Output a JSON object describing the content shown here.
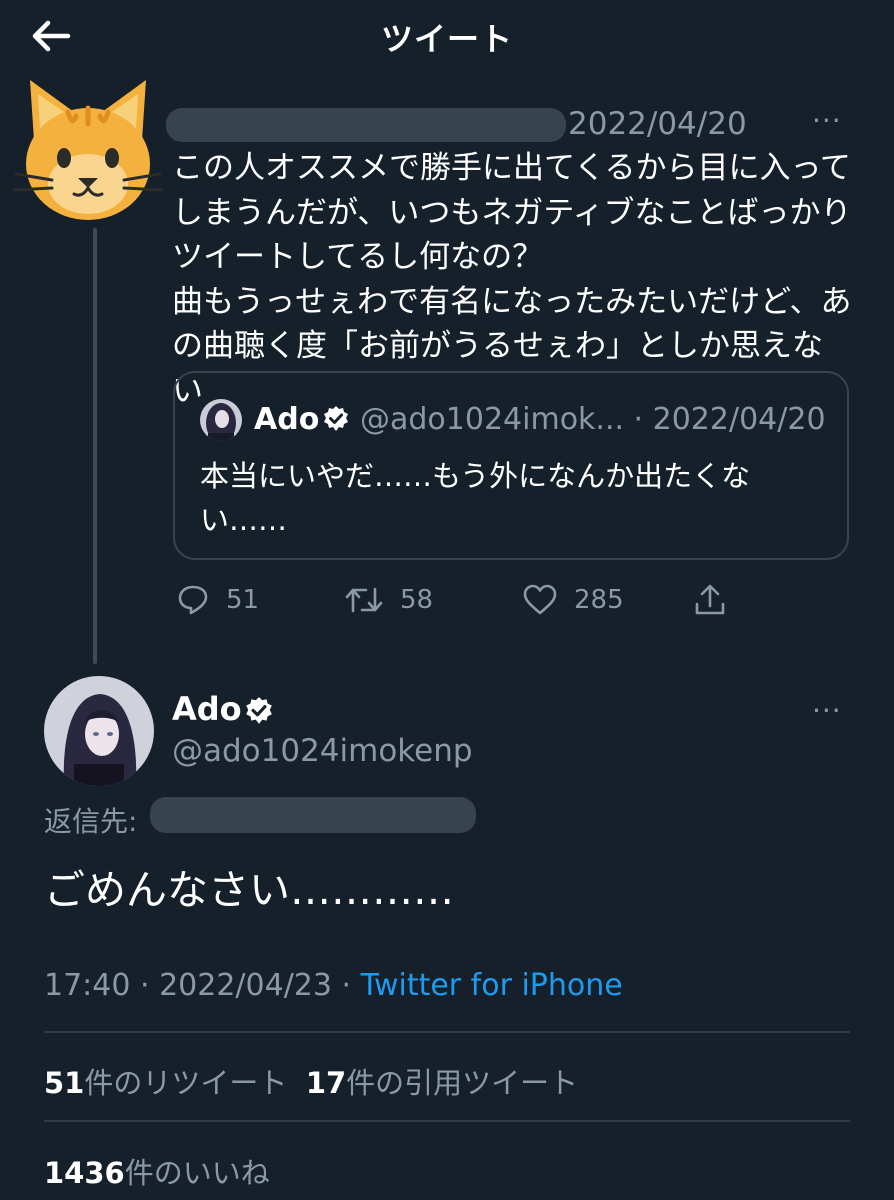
{
  "header": {
    "title": "ツイート",
    "back_icon": "arrow-left-icon"
  },
  "colors": {
    "background": "#15202b",
    "text": "#ffffff",
    "muted": "#8b98a5",
    "link": "#1d9bf0",
    "border": "#38444d"
  },
  "original_tweet": {
    "avatar_icon": "cat-face-icon",
    "date": "2022/04/20",
    "more_label": "···",
    "body": "この人オススメで勝手に出てくるから目に入って\nしまうんだが、いつもネガティブなことばっかり\nツイートしてるし何なの？\n曲もうっせぇわで有名になったみたいだけど、あ\nの曲聴く度「お前がうるせぇわ」としか思えない",
    "quote": {
      "name": "Ado",
      "handle": "@ado1024imok... · 2022/04/20",
      "body": "本当にいやだ……もう外になんか出たくな\nい……"
    },
    "actions": {
      "replies": "51",
      "retweets": "58",
      "likes": "285"
    }
  },
  "reply_tweet": {
    "name": "Ado",
    "handle": "@ado1024imokenp",
    "more_label": "···",
    "reply_to_label": "返信先:",
    "text": "ごめんなさい…………",
    "time_date": "17:40 · 2022/04/23 · ",
    "source": "Twitter for iPhone",
    "stats": {
      "retweet_count": "51",
      "retweet_label": "件のリツイート",
      "quote_count": "17",
      "quote_label": "件の引用ツイート",
      "like_count": "1436",
      "like_label": "件のいいね"
    }
  }
}
